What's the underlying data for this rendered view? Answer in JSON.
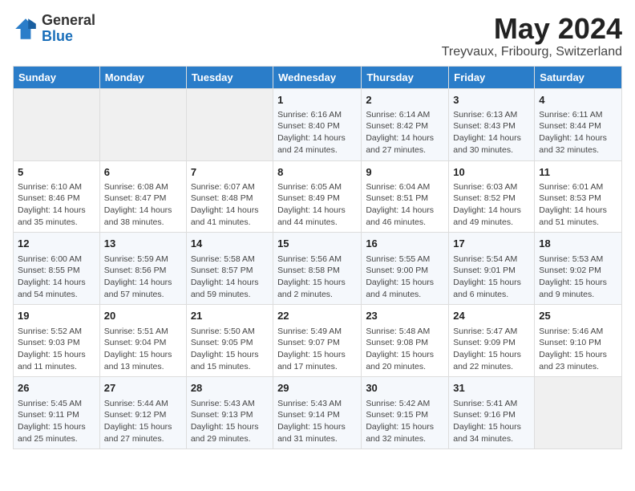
{
  "header": {
    "logo_general": "General",
    "logo_blue": "Blue",
    "month_title": "May 2024",
    "subtitle": "Treyvaux, Fribourg, Switzerland"
  },
  "days_of_week": [
    "Sunday",
    "Monday",
    "Tuesday",
    "Wednesday",
    "Thursday",
    "Friday",
    "Saturday"
  ],
  "weeks": [
    [
      {
        "day": "",
        "info": ""
      },
      {
        "day": "",
        "info": ""
      },
      {
        "day": "",
        "info": ""
      },
      {
        "day": "1",
        "info": "Sunrise: 6:16 AM\nSunset: 8:40 PM\nDaylight: 14 hours and 24 minutes."
      },
      {
        "day": "2",
        "info": "Sunrise: 6:14 AM\nSunset: 8:42 PM\nDaylight: 14 hours and 27 minutes."
      },
      {
        "day": "3",
        "info": "Sunrise: 6:13 AM\nSunset: 8:43 PM\nDaylight: 14 hours and 30 minutes."
      },
      {
        "day": "4",
        "info": "Sunrise: 6:11 AM\nSunset: 8:44 PM\nDaylight: 14 hours and 32 minutes."
      }
    ],
    [
      {
        "day": "5",
        "info": "Sunrise: 6:10 AM\nSunset: 8:46 PM\nDaylight: 14 hours and 35 minutes."
      },
      {
        "day": "6",
        "info": "Sunrise: 6:08 AM\nSunset: 8:47 PM\nDaylight: 14 hours and 38 minutes."
      },
      {
        "day": "7",
        "info": "Sunrise: 6:07 AM\nSunset: 8:48 PM\nDaylight: 14 hours and 41 minutes."
      },
      {
        "day": "8",
        "info": "Sunrise: 6:05 AM\nSunset: 8:49 PM\nDaylight: 14 hours and 44 minutes."
      },
      {
        "day": "9",
        "info": "Sunrise: 6:04 AM\nSunset: 8:51 PM\nDaylight: 14 hours and 46 minutes."
      },
      {
        "day": "10",
        "info": "Sunrise: 6:03 AM\nSunset: 8:52 PM\nDaylight: 14 hours and 49 minutes."
      },
      {
        "day": "11",
        "info": "Sunrise: 6:01 AM\nSunset: 8:53 PM\nDaylight: 14 hours and 51 minutes."
      }
    ],
    [
      {
        "day": "12",
        "info": "Sunrise: 6:00 AM\nSunset: 8:55 PM\nDaylight: 14 hours and 54 minutes."
      },
      {
        "day": "13",
        "info": "Sunrise: 5:59 AM\nSunset: 8:56 PM\nDaylight: 14 hours and 57 minutes."
      },
      {
        "day": "14",
        "info": "Sunrise: 5:58 AM\nSunset: 8:57 PM\nDaylight: 14 hours and 59 minutes."
      },
      {
        "day": "15",
        "info": "Sunrise: 5:56 AM\nSunset: 8:58 PM\nDaylight: 15 hours and 2 minutes."
      },
      {
        "day": "16",
        "info": "Sunrise: 5:55 AM\nSunset: 9:00 PM\nDaylight: 15 hours and 4 minutes."
      },
      {
        "day": "17",
        "info": "Sunrise: 5:54 AM\nSunset: 9:01 PM\nDaylight: 15 hours and 6 minutes."
      },
      {
        "day": "18",
        "info": "Sunrise: 5:53 AM\nSunset: 9:02 PM\nDaylight: 15 hours and 9 minutes."
      }
    ],
    [
      {
        "day": "19",
        "info": "Sunrise: 5:52 AM\nSunset: 9:03 PM\nDaylight: 15 hours and 11 minutes."
      },
      {
        "day": "20",
        "info": "Sunrise: 5:51 AM\nSunset: 9:04 PM\nDaylight: 15 hours and 13 minutes."
      },
      {
        "day": "21",
        "info": "Sunrise: 5:50 AM\nSunset: 9:05 PM\nDaylight: 15 hours and 15 minutes."
      },
      {
        "day": "22",
        "info": "Sunrise: 5:49 AM\nSunset: 9:07 PM\nDaylight: 15 hours and 17 minutes."
      },
      {
        "day": "23",
        "info": "Sunrise: 5:48 AM\nSunset: 9:08 PM\nDaylight: 15 hours and 20 minutes."
      },
      {
        "day": "24",
        "info": "Sunrise: 5:47 AM\nSunset: 9:09 PM\nDaylight: 15 hours and 22 minutes."
      },
      {
        "day": "25",
        "info": "Sunrise: 5:46 AM\nSunset: 9:10 PM\nDaylight: 15 hours and 23 minutes."
      }
    ],
    [
      {
        "day": "26",
        "info": "Sunrise: 5:45 AM\nSunset: 9:11 PM\nDaylight: 15 hours and 25 minutes."
      },
      {
        "day": "27",
        "info": "Sunrise: 5:44 AM\nSunset: 9:12 PM\nDaylight: 15 hours and 27 minutes."
      },
      {
        "day": "28",
        "info": "Sunrise: 5:43 AM\nSunset: 9:13 PM\nDaylight: 15 hours and 29 minutes."
      },
      {
        "day": "29",
        "info": "Sunrise: 5:43 AM\nSunset: 9:14 PM\nDaylight: 15 hours and 31 minutes."
      },
      {
        "day": "30",
        "info": "Sunrise: 5:42 AM\nSunset: 9:15 PM\nDaylight: 15 hours and 32 minutes."
      },
      {
        "day": "31",
        "info": "Sunrise: 5:41 AM\nSunset: 9:16 PM\nDaylight: 15 hours and 34 minutes."
      },
      {
        "day": "",
        "info": ""
      }
    ]
  ]
}
